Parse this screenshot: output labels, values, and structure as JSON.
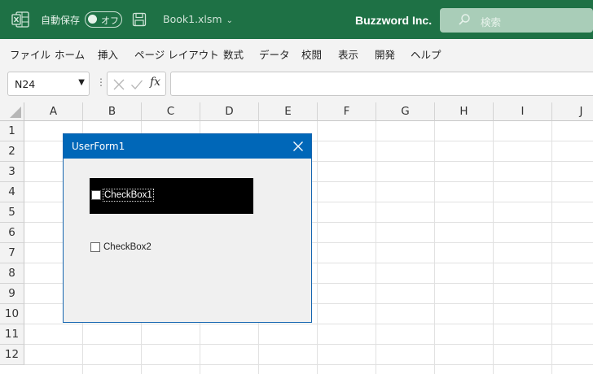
{
  "titlebar": {
    "autosave_label": "自動保存",
    "autosave_state": "オフ",
    "filename": "Book1.xlsm",
    "company": "Buzzword Inc.",
    "search_placeholder": "検索",
    "bg_color": "#1e7145"
  },
  "menu": {
    "items": [
      "ファイル",
      "ホーム",
      "挿入",
      "ページ レイアウト",
      "数式",
      "データ",
      "校閲",
      "表示",
      "開発",
      "ヘルプ"
    ]
  },
  "formula_bar": {
    "name_box": "N24",
    "fx_label": "fx",
    "formula": ""
  },
  "sheet": {
    "columns": [
      "A",
      "B",
      "C",
      "D",
      "E",
      "F",
      "G",
      "H",
      "I",
      "J"
    ],
    "rows": [
      "1",
      "2",
      "3",
      "4",
      "5",
      "6",
      "7",
      "8",
      "9",
      "10",
      "11",
      "12"
    ]
  },
  "userform": {
    "title": "UserForm1",
    "title_color": "#0067b8",
    "checkbox1_label": "CheckBox1",
    "checkbox1_checked": false,
    "checkbox1_backcolor": "#000000",
    "checkbox2_label": "CheckBox2",
    "checkbox2_checked": false
  }
}
